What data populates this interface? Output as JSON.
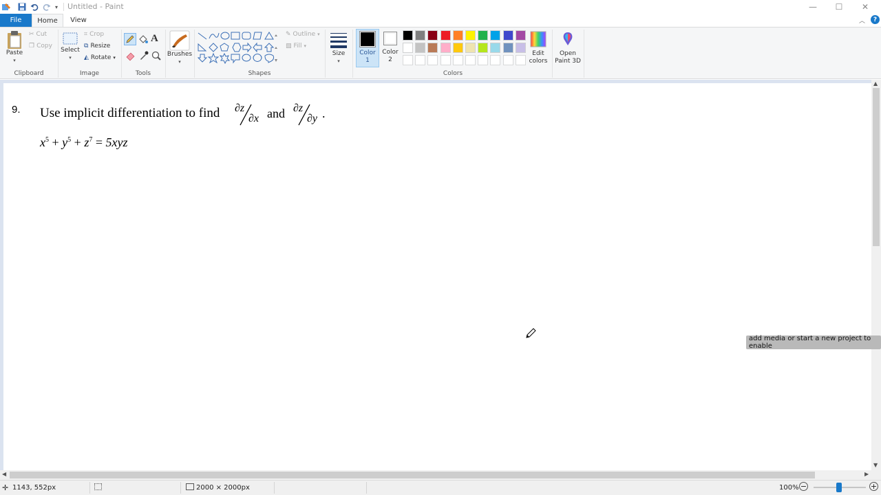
{
  "window": {
    "title": "Untitled - Paint",
    "controls": {
      "minimize": "—",
      "maximize": "☐",
      "close": "✕"
    }
  },
  "tabs": {
    "file": "File",
    "home": "Home",
    "view": "View"
  },
  "ribbon": {
    "clipboard": {
      "label": "Clipboard",
      "paste": "Paste",
      "cut": "Cut",
      "copy": "Copy"
    },
    "image": {
      "label": "Image",
      "select": "Select",
      "crop": "Crop",
      "resize": "Resize",
      "rotate": "Rotate"
    },
    "tools": {
      "label": "Tools"
    },
    "brushes": {
      "label": "Brushes"
    },
    "shapes": {
      "label": "Shapes",
      "outline": "Outline",
      "fill": "Fill"
    },
    "size": {
      "label": "Size"
    },
    "color1": {
      "label1": "Color",
      "label2": "1",
      "value": "#000000"
    },
    "color2": {
      "label1": "Color",
      "label2": "2",
      "value": "#ffffff"
    },
    "colors": {
      "label": "Colors",
      "row1": [
        "#000000",
        "#7f7f7f",
        "#880015",
        "#ed1c24",
        "#ff7f27",
        "#fff200",
        "#22b14c",
        "#00a2e8",
        "#3f48cc",
        "#a349a4"
      ],
      "row2": [
        "#ffffff",
        "#c3c3c3",
        "#b97a57",
        "#ffaec9",
        "#ffc90e",
        "#efe4b0",
        "#b5e61d",
        "#99d9ea",
        "#7092be",
        "#c8bfe7"
      ]
    },
    "edit_colors": {
      "line1": "Edit",
      "line2": "colors"
    },
    "paint3d": {
      "line1": "Open",
      "line2": "Paint 3D"
    }
  },
  "canvas_content": {
    "problem_number": "9.",
    "instruction": "Use implicit differentiation to find",
    "frac1": {
      "num": "∂z",
      "den": "∂x"
    },
    "conj": "and",
    "frac2": {
      "num": "∂z",
      "den": "∂y"
    },
    "period": ".",
    "equation": {
      "x": "x",
      "e1": "5",
      "plus1": "+",
      "y": "y",
      "e2": "5",
      "plus2": "+",
      "z": "z",
      "e3": "7",
      "eq": "=",
      "rhs": "5xyz"
    }
  },
  "tooltip": "add media or start a new project to enable",
  "status": {
    "cursor_pos": "1143, 552px",
    "canvas_size": "2000 × 2000px",
    "zoom": "100%"
  }
}
